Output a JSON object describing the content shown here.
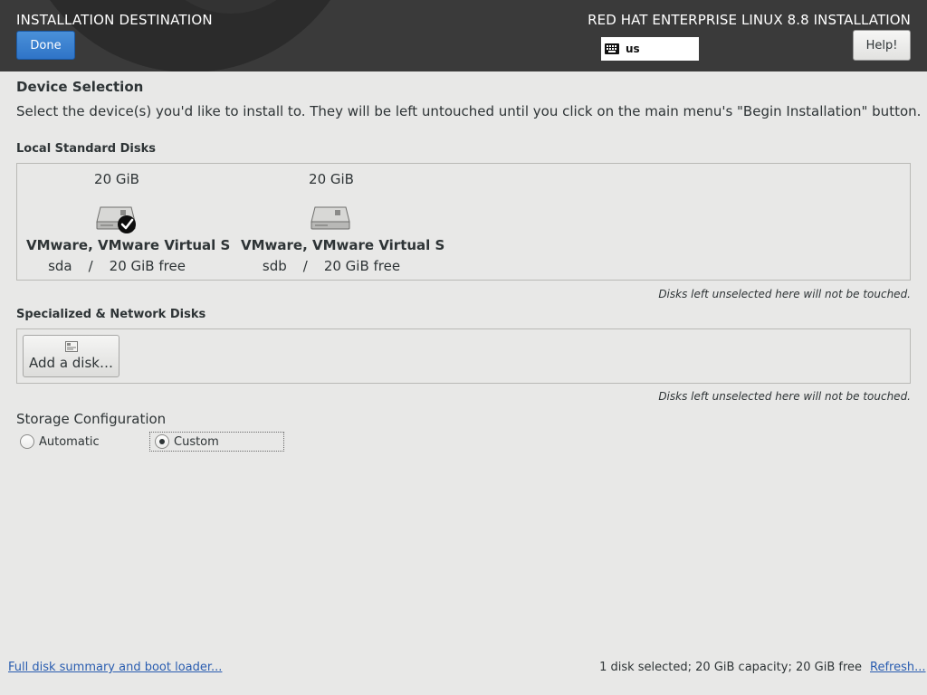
{
  "header": {
    "title": "INSTALLATION DESTINATION",
    "done_label": "Done",
    "product": "RED HAT ENTERPRISE LINUX 8.8 INSTALLATION",
    "keyboard_layout": "us",
    "keyboard_icon": "keyboard-icon",
    "help_label": "Help!"
  },
  "device_selection": {
    "title": "Device Selection",
    "intro": "Select the device(s) you'd like to install to.  They will be left untouched until you click on the main menu's \"Begin Installation\" button."
  },
  "local_disks": {
    "label": "Local Standard Disks",
    "disks": [
      {
        "capacity": "20 GiB",
        "name": "VMware, VMware Virtual S",
        "device": "sda",
        "separator": "/",
        "free": "20 GiB free",
        "selected": true,
        "icon": "hard-disk-icon"
      },
      {
        "capacity": "20 GiB",
        "name": "VMware, VMware Virtual S",
        "device": "sdb",
        "separator": "/",
        "free": "20 GiB free",
        "selected": false,
        "icon": "hard-disk-icon"
      }
    ],
    "note": "Disks left unselected here will not be touched."
  },
  "specialized_disks": {
    "label": "Specialized & Network Disks",
    "add_disk_label": "Add a disk…",
    "note": "Disks left unselected here will not be touched."
  },
  "storage_config": {
    "title": "Storage Configuration",
    "options": [
      {
        "label": "Automatic",
        "selected": false
      },
      {
        "label": "Custom",
        "selected": true
      }
    ]
  },
  "footer": {
    "summary_link": "Full disk summary and boot loader...",
    "status": "1 disk selected; 20 GiB capacity; 20 GiB free",
    "refresh_link": "Refresh..."
  },
  "colors": {
    "header_bg": "#3a3a3a",
    "done_button": "#3b82d4",
    "content_bg": "#e8e8e7",
    "link": "#2a5db0"
  }
}
